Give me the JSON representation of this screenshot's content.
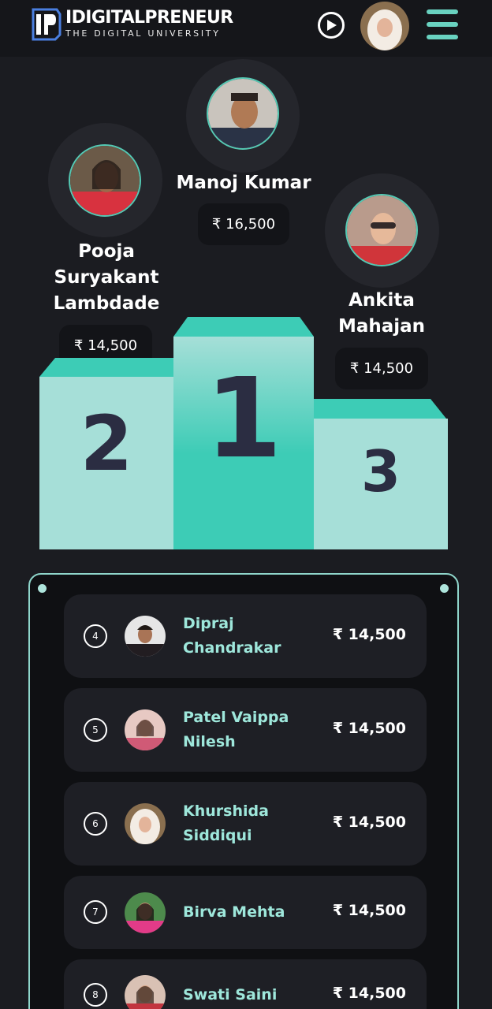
{
  "header": {
    "brand_name": "IDIGITALPRENEUR",
    "brand_tagline": "THE DIGITAL UNIVERSITY",
    "logo_icon": "ip-logo-icon",
    "play_icon": "play-circle-icon",
    "menu_icon": "hamburger-menu-icon"
  },
  "top3": [
    {
      "rank": "1",
      "name": "Manoj Kumar",
      "amount": "₹ 16,500"
    },
    {
      "rank": "2",
      "name": "Pooja Suryakant Lambdade",
      "amount": "₹ 14,500"
    },
    {
      "rank": "3",
      "name": "Ankita Mahajan",
      "amount": "₹ 14,500"
    }
  ],
  "podium": {
    "first": "1",
    "second": "2",
    "third": "3"
  },
  "leaderboard": [
    {
      "rank": "4",
      "name": "Dipraj Chandrakar",
      "amount": "₹ 14,500"
    },
    {
      "rank": "5",
      "name": "Patel Vaippa Nilesh",
      "amount": "₹ 14,500"
    },
    {
      "rank": "6",
      "name": "Khurshida Siddiqui",
      "amount": "₹ 14,500"
    },
    {
      "rank": "7",
      "name": "Birva Mehta",
      "amount": "₹ 14,500"
    },
    {
      "rank": "8",
      "name": "Swati Saini",
      "amount": "₹ 14,500"
    }
  ],
  "colors": {
    "background": "#1b1c21",
    "accent": "#69d2c0",
    "podium_light": "#a6dfd8",
    "podium_main": "#3dccb6",
    "rank_text": "#2b2d42",
    "name_accent": "#9ee7db"
  }
}
